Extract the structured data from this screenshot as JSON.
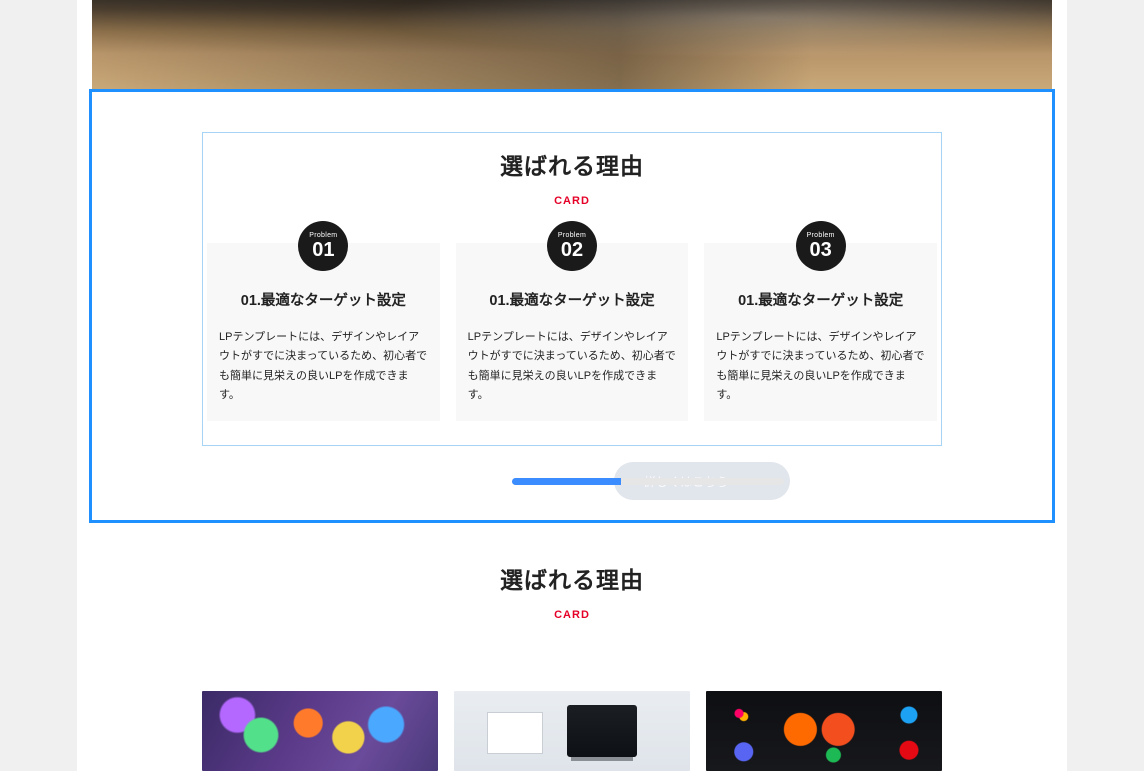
{
  "section1": {
    "title": "選ばれる理由",
    "subtitle": "CARD",
    "badge_label": "Problem",
    "cards": [
      {
        "num": "01",
        "title": "01.最適なターゲット設定",
        "desc": "LPテンプレートには、デザインやレイアウトがすでに決まっているため、初心者でも簡単に見栄えの良いLPを作成できます。"
      },
      {
        "num": "02",
        "title": "01.最適なターゲット設定",
        "desc": "LPテンプレートには、デザインやレイアウトがすでに決まっているため、初心者でも簡単に見栄えの良いLPを作成できます。"
      },
      {
        "num": "03",
        "title": "01.最適なターゲット設定",
        "desc": "LPテンプレートには、デザインやレイアウトがすでに決まっているため、初心者でも簡単に見栄えの良いLPを作成できます。"
      }
    ],
    "cta": "詳しくはこちら"
  },
  "section2": {
    "title": "選ばれる理由",
    "subtitle": "CARD"
  }
}
